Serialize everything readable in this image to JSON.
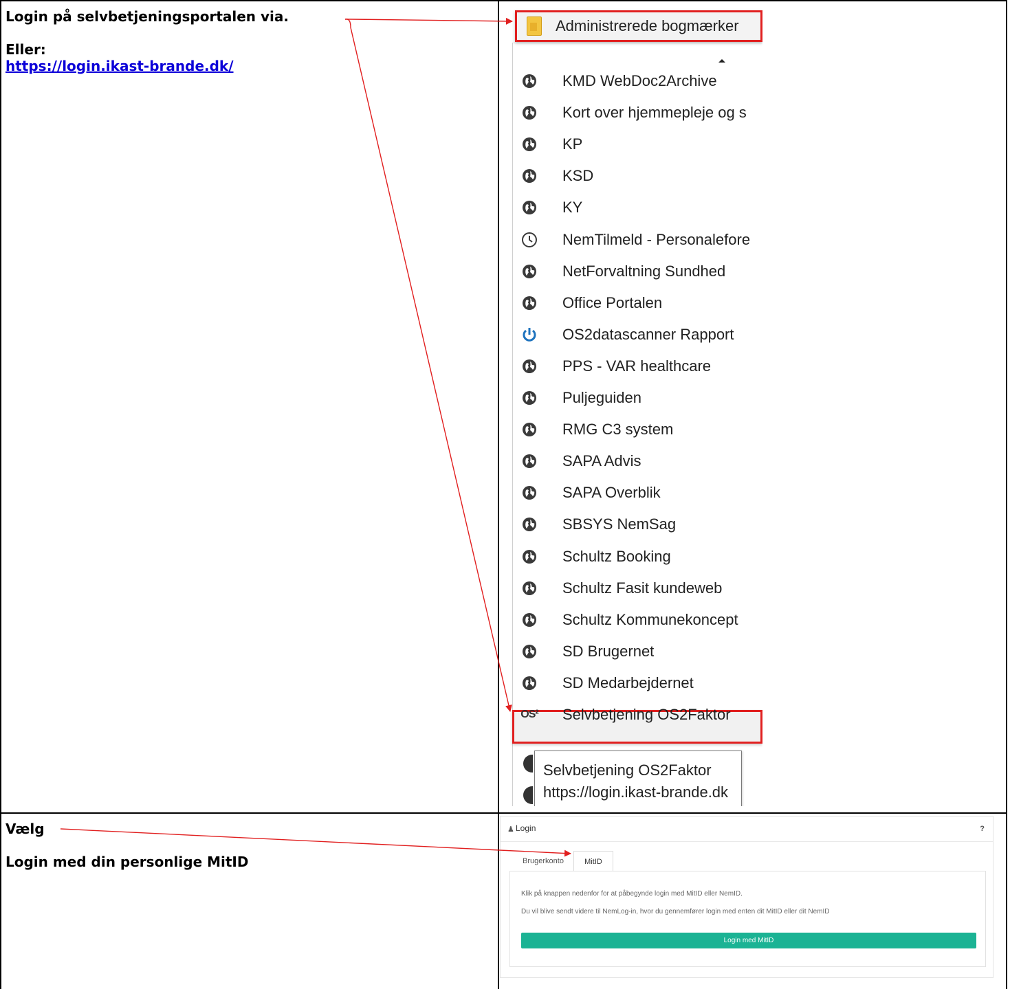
{
  "step1": {
    "title": "Login på selvbetjeningsportalen via.",
    "alt_label": "Eller:",
    "link": "https://login.ikast-brande.dk/"
  },
  "bookmarks": {
    "header": "Administrerede bogmærker",
    "items": [
      {
        "label": "KMD WebDoc2Archive",
        "icon": "globe-icon"
      },
      {
        "label": "Kort over hjemmepleje og s",
        "icon": "globe-icon"
      },
      {
        "label": "KP",
        "icon": "globe-icon"
      },
      {
        "label": "KSD",
        "icon": "globe-icon"
      },
      {
        "label": "KY",
        "icon": "globe-icon"
      },
      {
        "label": "NemTilmeld - Personalefore",
        "icon": "clock-icon"
      },
      {
        "label": "NetForvaltning Sundhed",
        "icon": "globe-icon"
      },
      {
        "label": "Office Portalen",
        "icon": "globe-icon"
      },
      {
        "label": "OS2datascanner Rapport",
        "icon": "power-icon"
      },
      {
        "label": "PPS - VAR healthcare",
        "icon": "globe-icon"
      },
      {
        "label": "Puljeguiden",
        "icon": "globe-icon"
      },
      {
        "label": "RMG C3 system",
        "icon": "globe-icon"
      },
      {
        "label": "SAPA Advis",
        "icon": "globe-icon"
      },
      {
        "label": "SAPA Overblik",
        "icon": "globe-icon"
      },
      {
        "label": "SBSYS NemSag",
        "icon": "globe-icon"
      },
      {
        "label": "Schultz Booking",
        "icon": "globe-icon"
      },
      {
        "label": "Schultz Fasit kundeweb",
        "icon": "globe-icon"
      },
      {
        "label": "Schultz Kommunekoncept",
        "icon": "globe-icon"
      },
      {
        "label": "SD Brugernet",
        "icon": "globe-icon"
      },
      {
        "label": "SD Medarbejdernet",
        "icon": "globe-icon"
      },
      {
        "label": "Selvbetjening OS2Faktor",
        "icon": "os2-logo-icon"
      }
    ],
    "os2_mark": "OS²",
    "tooltip": {
      "line1": "Selvbetjening OS2Faktor",
      "line2": "https://login.ikast-brande.dk"
    }
  },
  "step2": {
    "choose": "Vælg",
    "instruction": "Login med din personlige MitID"
  },
  "login": {
    "title": "Login",
    "help": "?",
    "tabs": [
      "Brugerkonto",
      "MitID"
    ],
    "active_tab": "MitID",
    "text1": "Klik på knappen nedenfor for at påbegynde login med MitID eller NemID.",
    "text2": "Du vil blive sendt videre til NemLog-in, hvor du gennemfører login med enten dit MitID eller dit NemID",
    "button": "Login med MitID",
    "button_color": "#1bb394"
  },
  "colors": {
    "annotation": "#e11f1f",
    "link": "#0b00d8"
  }
}
